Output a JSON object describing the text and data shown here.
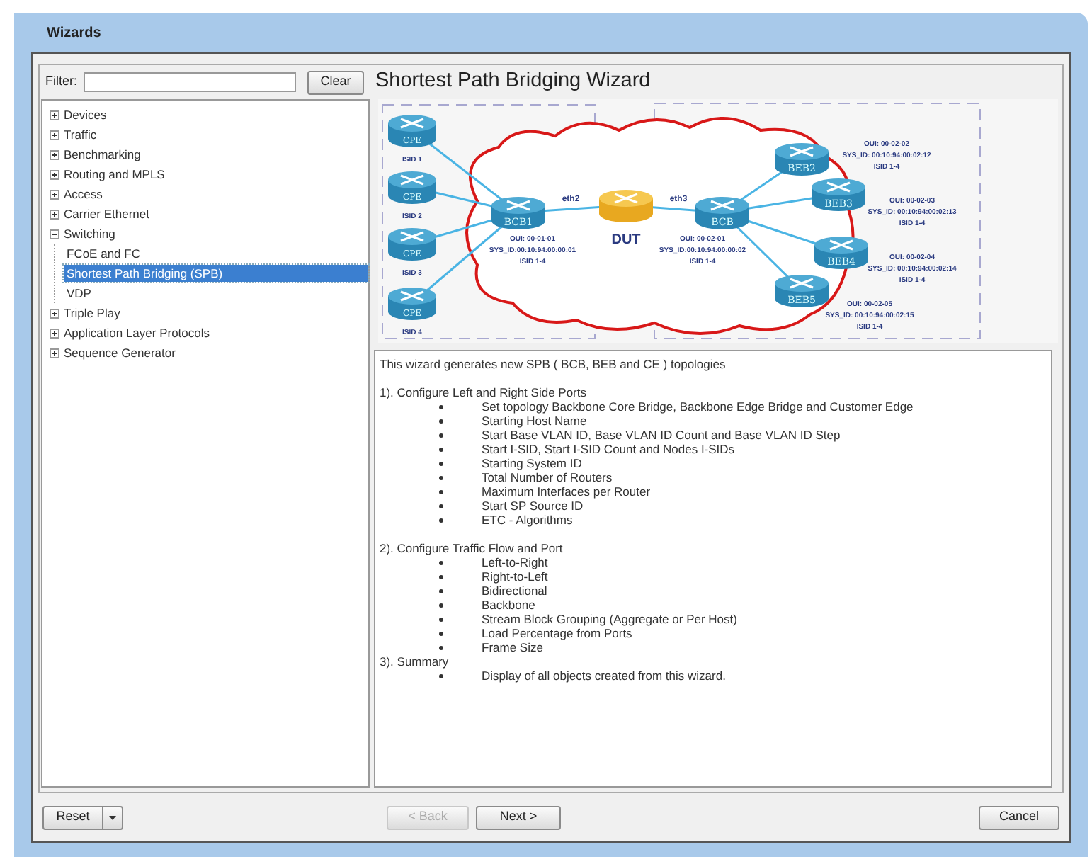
{
  "window": {
    "title": "Wizards"
  },
  "filter": {
    "label": "Filter:",
    "button": "Clear"
  },
  "tree": [
    {
      "label": "Devices",
      "expanded": false,
      "selected": false
    },
    {
      "label": "Traffic",
      "expanded": false,
      "selected": false
    },
    {
      "label": "Benchmarking",
      "expanded": false,
      "selected": false
    },
    {
      "label": "Routing and MPLS",
      "expanded": false,
      "selected": false
    },
    {
      "label": "Access",
      "expanded": false,
      "selected": false
    },
    {
      "label": "Carrier Ethernet",
      "expanded": false,
      "selected": false
    },
    {
      "label": "Switching",
      "expanded": true,
      "selected": false,
      "children": [
        {
          "label": "FCoE and FC",
          "selected": false
        },
        {
          "label": "Shortest Path Bridging (SPB)",
          "selected": true
        },
        {
          "label": "VDP",
          "selected": false
        }
      ]
    },
    {
      "label": "Triple Play",
      "expanded": false,
      "selected": false
    },
    {
      "label": "Application Layer Protocols",
      "expanded": false,
      "selected": false
    },
    {
      "label": "Sequence Generator",
      "expanded": false,
      "selected": false
    }
  ],
  "wizard_title": "Shortest Path Bridging Wizard",
  "diagram": {
    "nodes": [
      {
        "kind": "cpe",
        "label": "CPE",
        "info": [
          "ISID 1"
        ]
      },
      {
        "kind": "cpe",
        "label": "CPE",
        "info": [
          "ISID 2"
        ]
      },
      {
        "kind": "cpe",
        "label": "CPE",
        "info": [
          "ISID 3"
        ]
      },
      {
        "kind": "cpe",
        "label": "CPE",
        "info": [
          "ISID 4"
        ]
      },
      {
        "kind": "bridge",
        "label": "BCB1",
        "info": [
          "OUI: 00-01-01",
          "SYS_ID:00:10:94:00:00:01",
          "ISID 1-4"
        ]
      },
      {
        "kind": "dut",
        "info": [
          "DUT"
        ]
      },
      {
        "kind": "bridge",
        "label": "BCB",
        "info": [
          "OUI: 00-02-01",
          "SYS_ID:00:10:94:00:00:02",
          "ISID 1-4"
        ]
      },
      {
        "kind": "bridge",
        "label": "BEB2",
        "info": [
          "OUI: 00-02-02",
          "SYS_ID: 00:10:94:00:02:12",
          "ISID 1-4"
        ]
      },
      {
        "kind": "bridge",
        "label": "BEB3",
        "info": [
          "OUI: 00-02-03",
          "SYS_ID: 00:10:94:00:02:13",
          "ISID 1-4"
        ]
      },
      {
        "kind": "bridge",
        "label": "BEB4",
        "info": [
          "OUI: 00-02-04",
          "SYS_ID: 00:10:94:00:02:14",
          "ISID 1-4"
        ]
      },
      {
        "kind": "bridge",
        "label": "BEB5",
        "info": [
          "OUI: 00-02-05",
          "SYS_ID: 00:10:94:00:02:15",
          "ISID 1-4"
        ]
      }
    ],
    "ports": [
      "eth2",
      "eth3"
    ]
  },
  "description": {
    "intro": "This wizard generates new SPB ( BCB, BEB and CE ) topologies",
    "sections": [
      {
        "heading": "1). Configure Left and Right Side Ports",
        "items": [
          "Set topology Backbone Core Bridge, Backbone Edge Bridge and Customer Edge",
          "Starting Host Name",
          "Start Base VLAN ID, Base VLAN ID Count and Base VLAN ID Step",
          "Start I-SID, Start I-SID Count and Nodes I-SIDs",
          "Starting System ID",
          "Total Number of Routers",
          "Maximum Interfaces per Router",
          "Start SP Source ID",
          "ETC  - Algorithms"
        ]
      },
      {
        "heading": "2). Configure Traffic Flow and Port",
        "items": [
          "Left-to-Right",
          "Right-to-Left",
          "Bidirectional",
          "Backbone",
          "Stream Block Grouping (Aggregate or Per Host)",
          "Load Percentage from Ports",
          "Frame Size"
        ]
      },
      {
        "heading": "3). Summary",
        "items": [
          "Display of all objects created from this wizard."
        ]
      }
    ]
  },
  "buttons": {
    "reset": "Reset",
    "back": {
      "label": "< Back",
      "disabled": true
    },
    "next": {
      "label": "Next >",
      "disabled": false
    },
    "cancel": "Cancel"
  }
}
